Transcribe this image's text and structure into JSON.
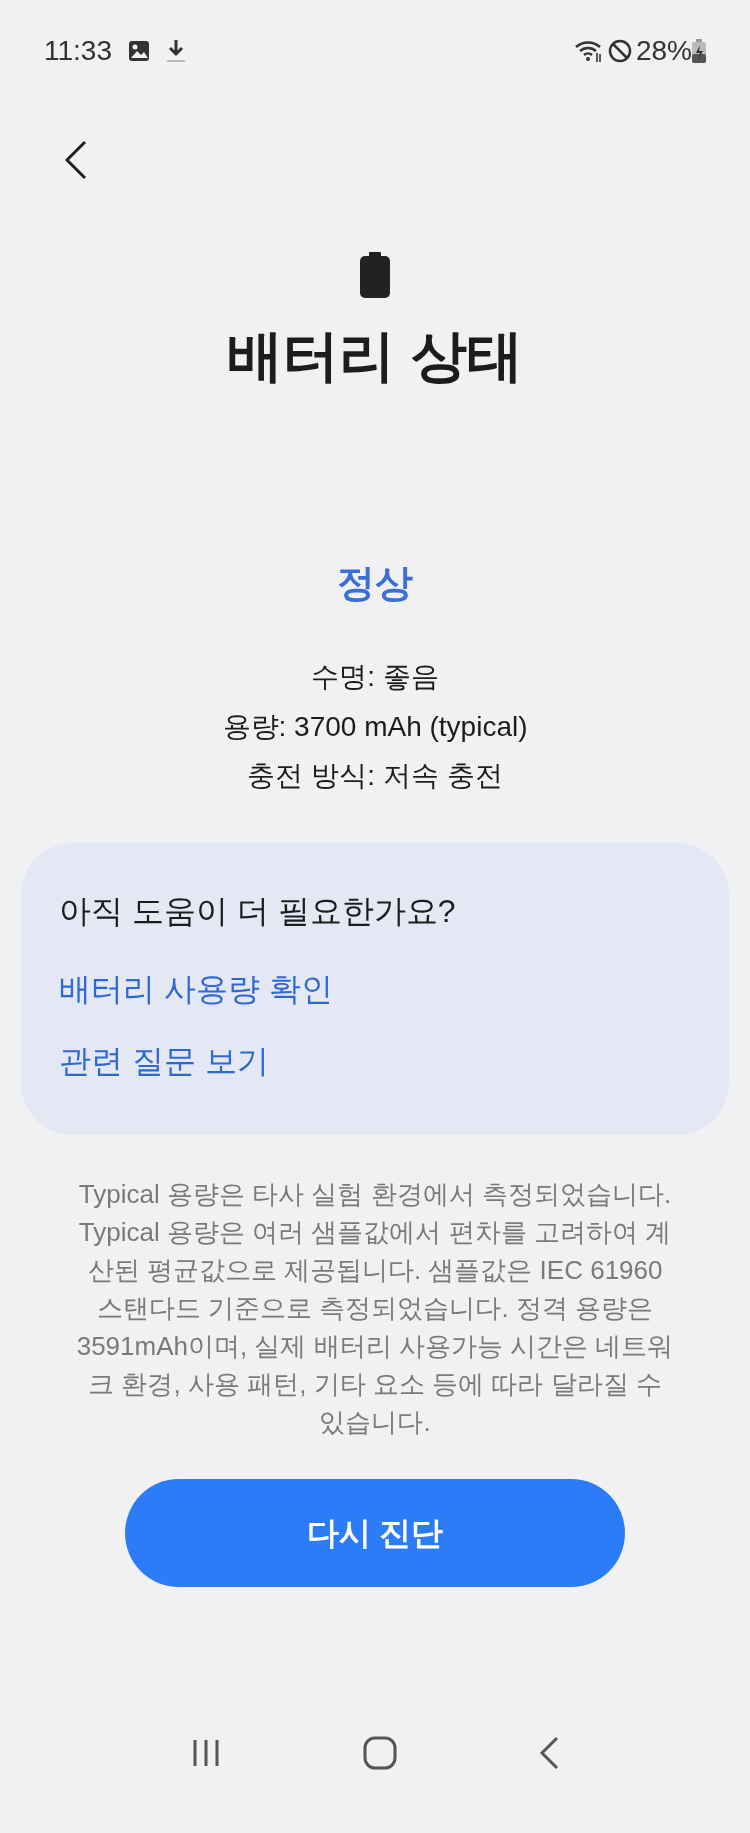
{
  "status_bar": {
    "time": "11:33",
    "battery_percent": "28%"
  },
  "title": "배터리 상태",
  "status": "정상",
  "details": [
    "수명: 좋음",
    "용량: 3700 mAh (typical)",
    "충전 방식: 저속 충전"
  ],
  "help_card": {
    "title": "아직 도움이 더 필요한가요?",
    "links": [
      "배터리 사용량 확인",
      "관련 질문 보기"
    ]
  },
  "disclaimer": "Typical 용량은 타사 실험 환경에서 측정되었습니다. Typical 용량은 여러 샘플값에서 편차를 고려하여 계산된 평균값으로 제공됩니다. 샘플값은 IEC 61960 스탠다드 기준으로 측정되었습니다. 정격 용량은 3591mAh이며, 실제 배터리 사용가능 시간은 네트워크 환경, 사용 패턴, 기타 요소 등에 따라 달라질 수 있습니다.",
  "action_button": "다시 진단"
}
